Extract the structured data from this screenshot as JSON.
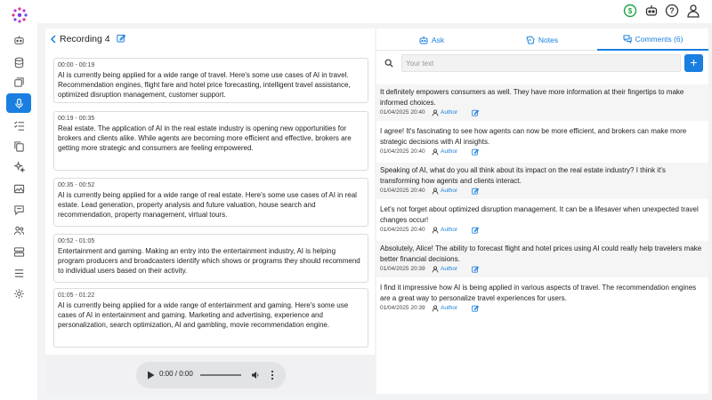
{
  "app": {
    "accent_color": "#1a7fe0"
  },
  "sidebar": {
    "items": [
      {
        "icon": "robot-icon"
      },
      {
        "icon": "database-icon"
      },
      {
        "icon": "gallery-icon"
      },
      {
        "icon": "microphone-icon",
        "active": true
      },
      {
        "icon": "checklist-icon"
      },
      {
        "icon": "copy-icon"
      },
      {
        "icon": "sparkles-icon"
      },
      {
        "icon": "image-icon"
      },
      {
        "icon": "chat-icon"
      },
      {
        "icon": "users-icon"
      },
      {
        "icon": "server-icon"
      },
      {
        "icon": "menu-icon"
      },
      {
        "icon": "settings-icon"
      }
    ]
  },
  "topbar": {
    "icons": [
      "dollar-icon",
      "bot-icon",
      "help-icon",
      "user-icon"
    ]
  },
  "recording": {
    "title": "Recording 4",
    "segments": [
      {
        "time": "00:00 - 00:19",
        "text": "AI is currently being applied for a wide range of travel. Here's some use cases of AI in travel. Recommendation engines, flight fare and hotel price forecasting, intelligent travel assistance, optimized disruption management, customer support."
      },
      {
        "time": "00:19 - 00:35",
        "text": "Real estate. The application of AI in the real estate industry is opening new opportunities for brokers and clients alike. While agents are becoming more efficient and effective, brokers are getting more strategic and consumers are feeling empowered."
      },
      {
        "time": "00:35 - 00:52",
        "text": "AI is currently being applied for a wide range of real estate. Here's some use cases of AI in real estate. Lead generation, property analysis and future valuation, house search and recommendation, property management, virtual tours."
      },
      {
        "time": "00:52 - 01:05",
        "text": "Entertainment and gaming. Making an entry into the entertainment industry, AI is helping program producers and broadcasters identify which shows or programs they should recommend to individual users based on their activity."
      },
      {
        "time": "01:05 - 01:22",
        "text": "AI is currently being applied for a wide range of entertainment and gaming. Here's some use cases of AI in entertainment and gaming. Marketing and advertising, experience and personalization, search optimization, AI and gambling, movie recommendation engine."
      }
    ],
    "audio_time": "0:00 / 0:00"
  },
  "tabs": [
    {
      "label": "Ask",
      "icon": "robot-icon"
    },
    {
      "label": "Notes",
      "icon": "note-icon"
    },
    {
      "label": "Comments (6)",
      "icon": "comments-icon",
      "active": true
    }
  ],
  "comment_input": {
    "placeholder": "Your text",
    "add_label": "+"
  },
  "comments": [
    {
      "text": "It definitely empowers consumers as well. They have more information at their fingertips to make informed choices.",
      "date": "01/04/2025 20:40",
      "author": "Author"
    },
    {
      "text": "I agree! It's fascinating to see how agents can now be more efficient, and brokers can make more strategic decisions with AI insights.",
      "date": "01/04/2025 20:40",
      "author": "Author"
    },
    {
      "text": "Speaking of AI, what do you all think about its impact on the real estate industry? I think it's transforming how agents and clients interact.",
      "date": "01/04/2025 20:40",
      "author": "Author"
    },
    {
      "text": "Let's not forget about optimized disruption management. It can be a lifesaver when unexpected travel changes occur!",
      "date": "01/04/2025 20:40",
      "author": "Author"
    },
    {
      "text": "Absolutely, Alice! The ability to forecast flight and hotel prices using AI could really help travelers make better financial decisions.",
      "date": "01/04/2025 20:39",
      "author": "Author"
    },
    {
      "text": "I find it impressive how AI is being applied in various aspects of travel. The recommendation engines are a great way to personalize travel experiences for users.",
      "date": "01/04/2025 20:39",
      "author": "Author"
    }
  ]
}
